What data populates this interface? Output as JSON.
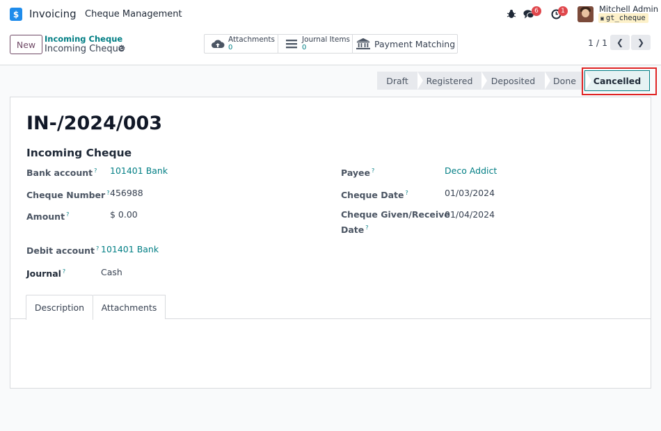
{
  "navbar": {
    "app_logo_glyph": "$",
    "app_name": "Invoicing",
    "menu": "Cheque Management",
    "icons": [
      "bug-icon",
      "chat-icon",
      "clock-icon"
    ],
    "chat_badge": "6",
    "activity_badge": "1",
    "user_name": "Mitchell Admin",
    "database": "gt_cheque"
  },
  "control": {
    "new_label": "New",
    "breadcrumb_parent": "Incoming Cheque",
    "breadcrumb_current": "Incoming Cheque",
    "smart_buttons": [
      {
        "label": "Attachments",
        "value": "0",
        "icon": "cloud-upload-icon"
      },
      {
        "label": "Journal Items",
        "value": "0",
        "icon": "list-icon"
      },
      {
        "label": "Payment Matching",
        "icon": "bank-icon"
      }
    ],
    "pager": "1 / 1"
  },
  "status": {
    "stages": [
      "Draft",
      "Registered",
      "Deposited",
      "Done",
      "Cancelled"
    ],
    "active": "Cancelled"
  },
  "form": {
    "name": "IN-/2024/003",
    "subtitle": "Incoming Cheque",
    "help_mark": "?",
    "left": [
      {
        "label": "Bank account",
        "value": "101401 Bank"
      },
      {
        "label": "Cheque Number",
        "value": "456988"
      },
      {
        "label": "Amount",
        "value": "$ 0.00"
      }
    ],
    "right": [
      {
        "label": "Payee",
        "value": "Deco Addict"
      },
      {
        "label": "Cheque Date",
        "value": "01/03/2024"
      },
      {
        "label_line1": "Cheque Given/Receive",
        "label_line2": "Date",
        "value": "01/04/2024"
      }
    ],
    "bottom": [
      {
        "label": "Debit account",
        "value": "101401 Bank"
      },
      {
        "label": "Journal",
        "value": "Cash"
      }
    ],
    "tabs": [
      "Description",
      "Attachments"
    ]
  }
}
